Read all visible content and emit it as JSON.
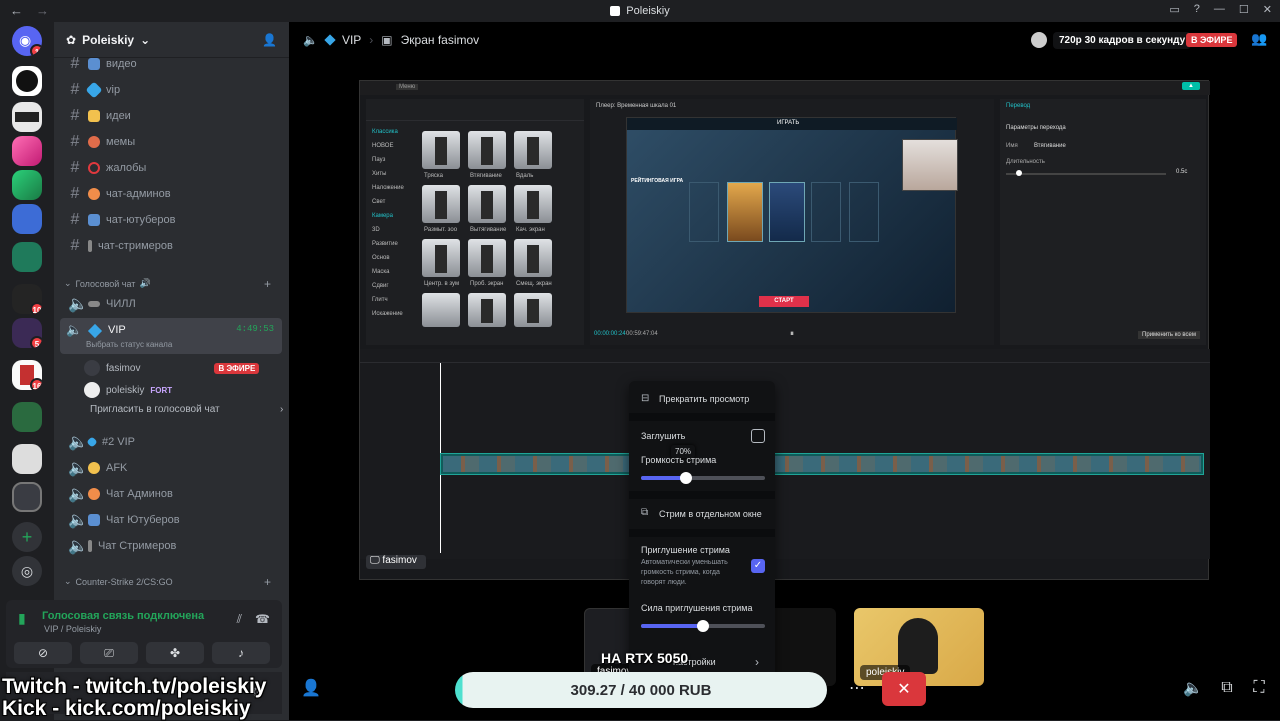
{
  "window": {
    "title": "Poleiskiy"
  },
  "servers": [
    {
      "badge": "1"
    },
    {
      "badge": ""
    },
    {
      "badge": ""
    },
    {
      "badge": ""
    },
    {
      "badge": ""
    },
    {
      "badge": ""
    },
    {
      "badge": ""
    },
    {
      "badge": "10"
    },
    {
      "badge": "5"
    },
    {
      "badge": "16"
    },
    {
      "badge": ""
    },
    {
      "badge": ""
    },
    {
      "badge": ""
    }
  ],
  "guild": {
    "name": "Poleiskiy"
  },
  "text_channels": [
    {
      "name": "видео",
      "color": "#5b8fd1"
    },
    {
      "name": "vip",
      "color": "#38a6e8"
    },
    {
      "name": "идеи",
      "color": "#f2c14e"
    },
    {
      "name": "мемы",
      "color": "#e06c4a"
    },
    {
      "name": "жалобы",
      "color": "#e0393e"
    },
    {
      "name": "чат-админов",
      "color": "#f08d4a"
    },
    {
      "name": "чат-ютуберов",
      "color": "#5b8fd1"
    },
    {
      "name": "чат-стримеров",
      "color": "#888"
    }
  ],
  "voice_category": "Голосовой чат",
  "voice_channels": {
    "chill": "ЧИЛЛ",
    "vip": {
      "name": "VIP",
      "time": "4:49:53",
      "status": "Выбрать статус канала"
    },
    "users": [
      {
        "name": "fasimov",
        "live": "В ЭФИРЕ"
      },
      {
        "name": "poleiskiy",
        "tag": "FORT"
      }
    ],
    "invite": "Пригласить в голосовой чат",
    "others": [
      "#2 VIP",
      "AFK",
      "Чат Админов",
      "Чат Ютуберов",
      "Чат Стримеров"
    ]
  },
  "cs_category": "Counter-Strike 2/CS:GO",
  "voice_panel": {
    "status": "Голосовая связь подключена",
    "channel": "VIP / Poleiskiy"
  },
  "topbar": {
    "channel": "VIP",
    "screen": "Экран fasimov",
    "quality": "720p 30 кадров в секунду",
    "live": "В ЭФИРЕ"
  },
  "stream_label": "fasimov",
  "capcut": {
    "menu": "Меню",
    "player_title": "Плеер: Временная шкала 01",
    "right_title": "Перевод",
    "params": "Параметры перехода",
    "name_label": "Имя",
    "name_value": "Втягивание",
    "duration_label": "Длительность",
    "duration_value": "0.5c",
    "apply_all": "Применить ко всем",
    "categories": [
      "Классика",
      "НОВОЕ",
      "Пауз",
      "Хиты",
      "Наложение",
      "Свет",
      "Камера",
      "3D",
      "Развитие",
      "Основ",
      "Маска",
      "Сдвиг",
      "Глитч",
      "Искажение"
    ],
    "thumbs": [
      "Тряска",
      "Втягивание",
      "Вдаль",
      "Размыт. зоо",
      "Вытягивание",
      "Кач. экран",
      "Центр. в зум",
      "Проб. экран",
      "Смещ. экран"
    ],
    "game_button": "СТАРТ",
    "game_title": "РЕЙТИНГОВАЯ ИГРА",
    "play_label": "ИГРАТЬ",
    "time_current": "00:00:00:24",
    "time_total": "00:59:47:04"
  },
  "popup": {
    "stop": "Прекратить просмотр",
    "mute": "Заглушить",
    "volume_label": "Громкость стрима",
    "volume_value": "70%",
    "volume_level": 0.36,
    "popout": "Стрим в отдельном окне",
    "attenuation": "Приглушение стрима",
    "attenuation_desc": "Автоматически уменьшать громкость стрима, когда говорят люди.",
    "attenuation_strength": "Сила приглушения стрима",
    "strength_level": 0.5,
    "settings": "настройки"
  },
  "tiles": [
    {
      "label": "fasimov"
    },
    {
      "label": "poleiskiy"
    }
  ],
  "donation": {
    "text": "309.27 / 40 000 RUB",
    "progress": 0.0077
  },
  "overlays": {
    "twitch": "Twitch - twitch.tv/poleiskiy",
    "kick": "Kick - kick.com/poleiskiy",
    "rtx": "НА RTX 5050"
  }
}
